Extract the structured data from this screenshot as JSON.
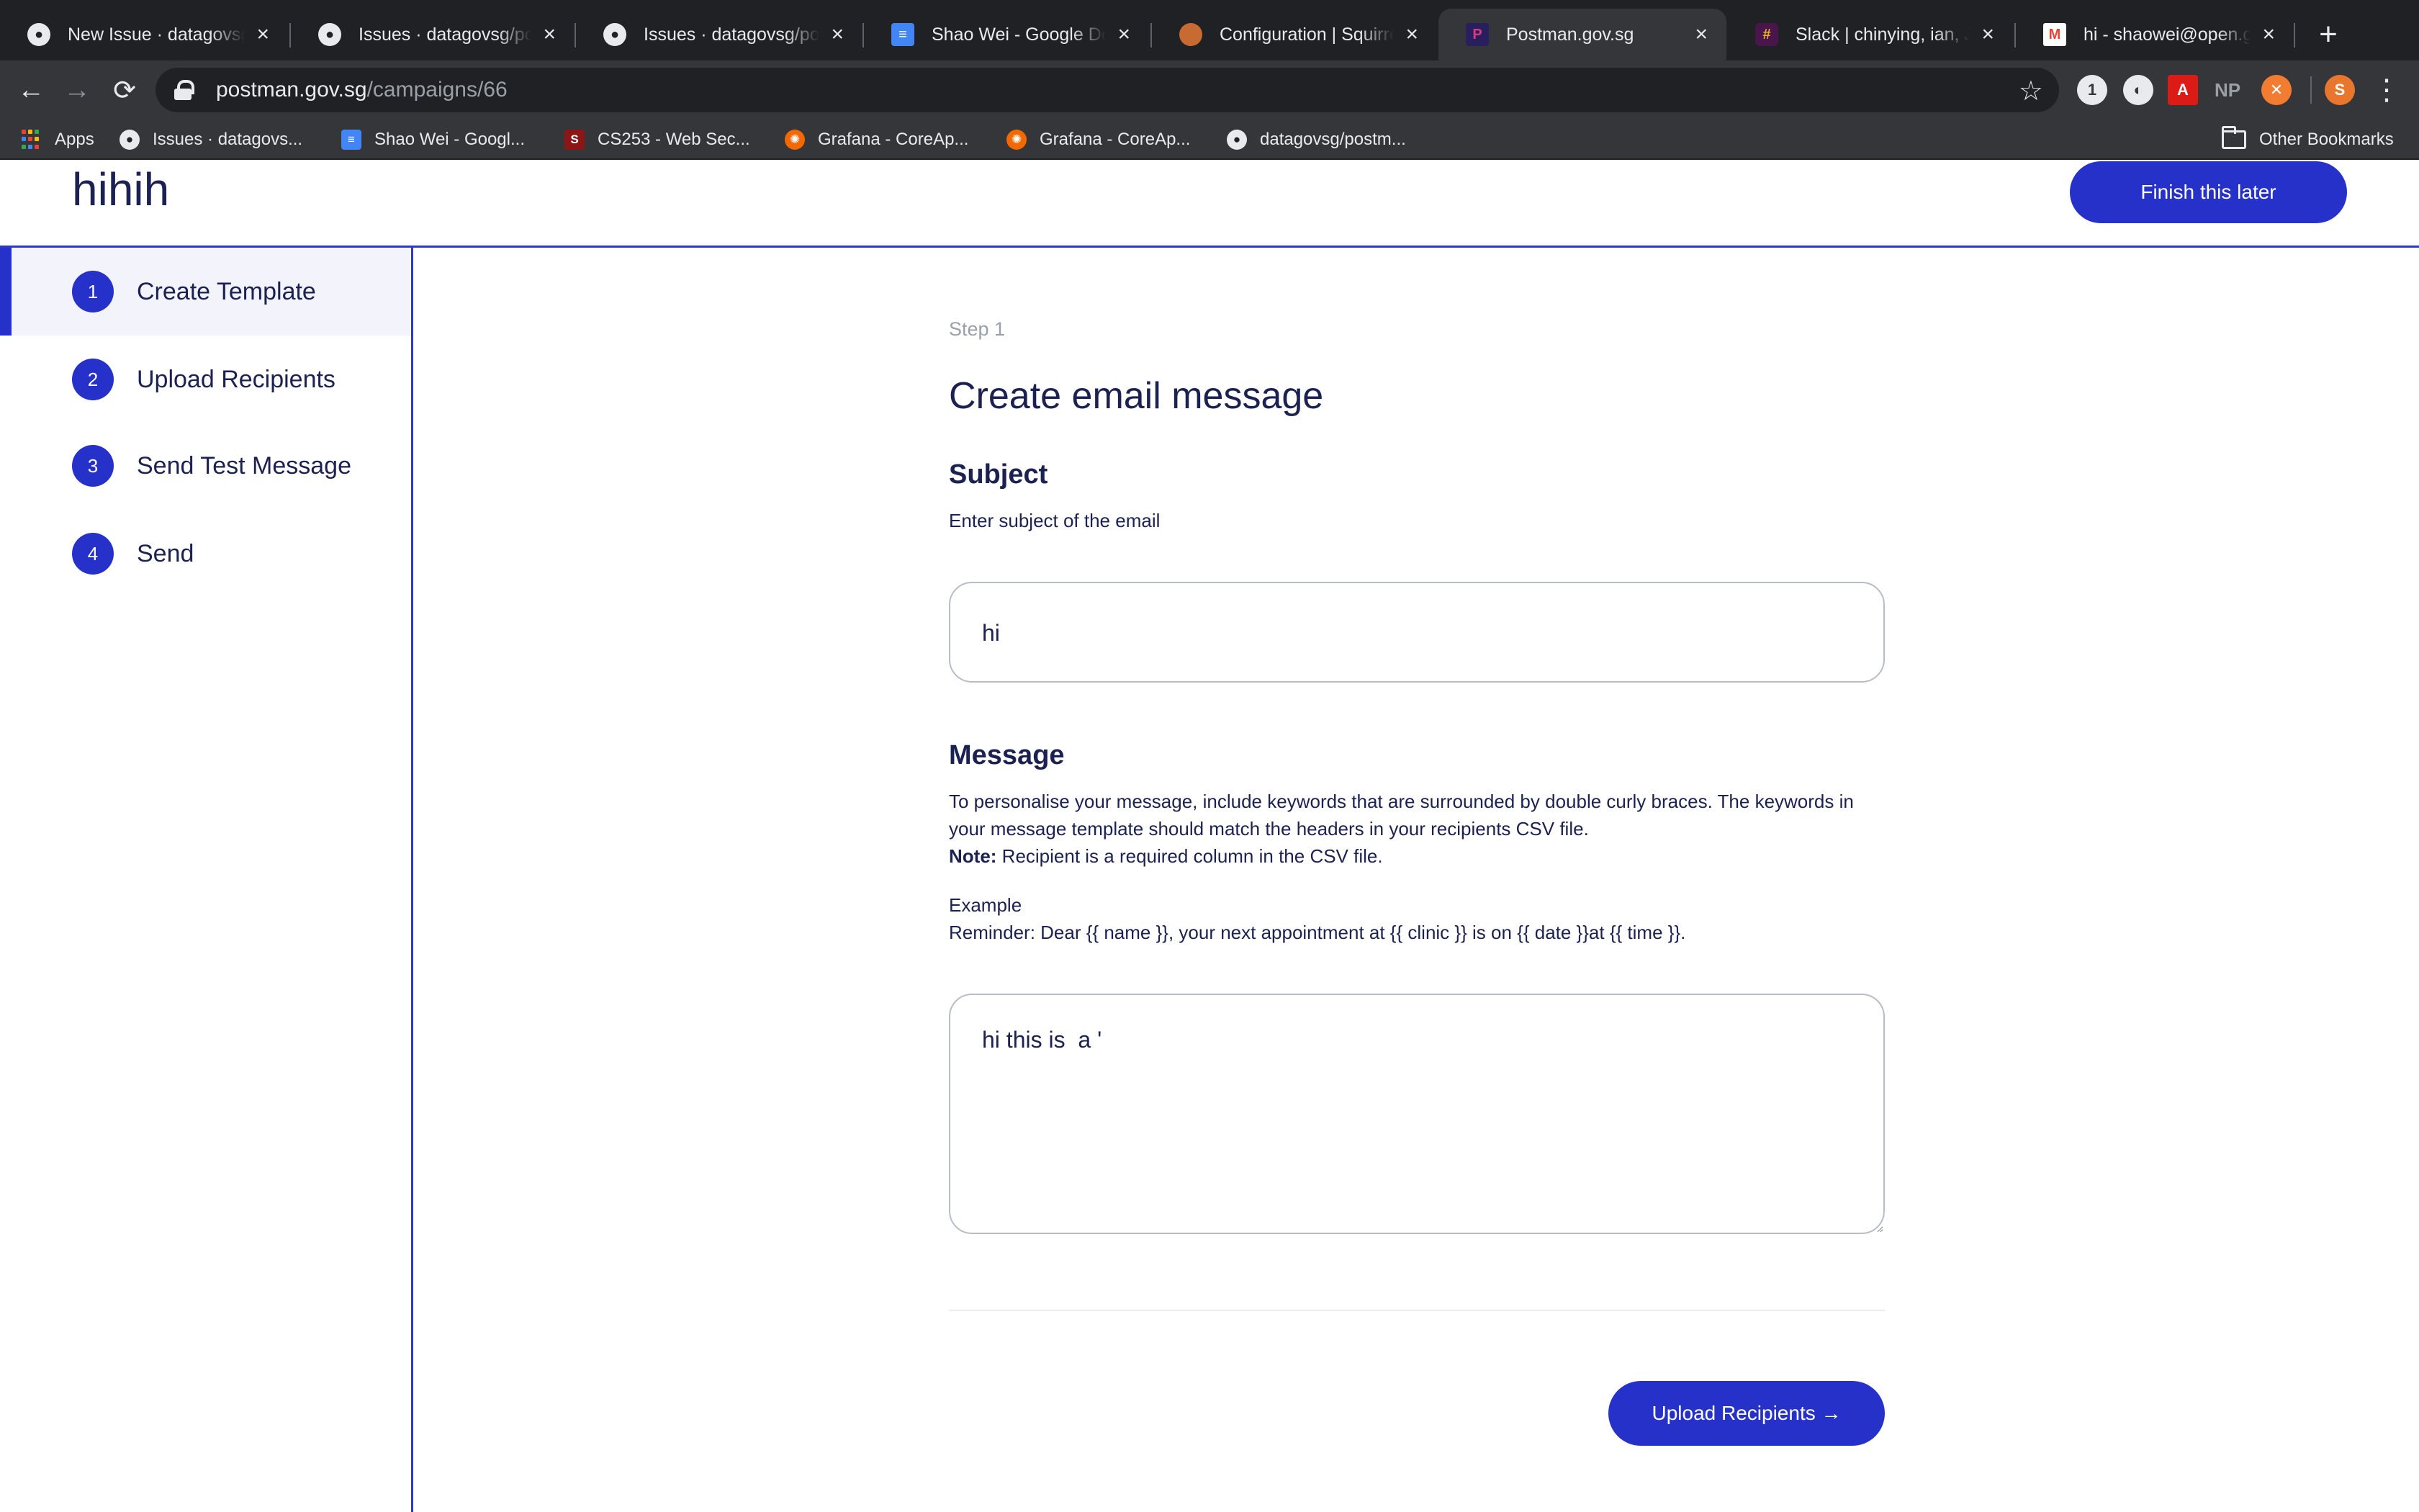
{
  "browser": {
    "tabs": [
      {
        "title": "New Issue · datagovsg/postman",
        "icon": "github-icon",
        "icon_color": "#e8eaed"
      },
      {
        "title": "Issues · datagovsg/postman",
        "icon": "github-icon",
        "icon_color": "#e8eaed"
      },
      {
        "title": "Issues · datagovsg/postman",
        "icon": "github-icon",
        "icon_color": "#e8eaed"
      },
      {
        "title": "Shao Wei - Google Docs",
        "icon": "google-docs-icon",
        "icon_color": "#4285f4"
      },
      {
        "title": "Configuration | SquirrelMail",
        "icon": "squirrel-icon",
        "icon_color": "#c86b32"
      },
      {
        "title": "Postman.gov.sg",
        "icon": "postman-icon",
        "icon_color": "#e0387a"
      },
      {
        "title": "Slack | chinying, ian, Jeff",
        "icon": "slack-icon",
        "icon_color": "#e01e5a"
      },
      {
        "title": "hi - shaowei@open.gov.sg",
        "icon": "gmail-icon",
        "icon_color": "#ea4335"
      }
    ],
    "new_tab_symbol": "+",
    "url": {
      "host": "postman.gov.sg",
      "path": "/campaigns/66"
    },
    "bookmarks": [
      {
        "label": "Apps",
        "icon": "apps-grid-icon"
      },
      {
        "label": "Issues · datagovs...",
        "icon": "github-icon"
      },
      {
        "label": "Shao Wei - Googl...",
        "icon": "google-docs-icon"
      },
      {
        "label": "CS253 - Web Sec...",
        "icon": "stanford-icon"
      },
      {
        "label": "Grafana - CoreAp...",
        "icon": "grafana-icon"
      },
      {
        "label": "Grafana - CoreAp...",
        "icon": "grafana-icon"
      },
      {
        "label": "datagovsg/postm...",
        "icon": "github-icon"
      }
    ],
    "other_bookmarks": "Other Bookmarks",
    "extensions": [
      "1password-icon",
      "extension-icon",
      "angular-icon",
      "np-extension-icon",
      "extension-orange-icon"
    ],
    "extension_np_label": "NP",
    "profile_initial": "S"
  },
  "app": {
    "campaign_name": "hihih",
    "finish_later_label": "Finish this later",
    "colors": {
      "primary": "#2631c9",
      "text": "#1b2151",
      "muted": "#9aa0aa"
    },
    "steps": [
      {
        "number": "1",
        "label": "Create Template",
        "active": true
      },
      {
        "number": "2",
        "label": "Upload Recipients",
        "active": false
      },
      {
        "number": "3",
        "label": "Send Test Message",
        "active": false
      },
      {
        "number": "4",
        "label": "Send",
        "active": false
      }
    ],
    "form": {
      "step_label": "Step 1",
      "heading": "Create email message",
      "subject_title": "Subject",
      "subject_help": "Enter subject of the email",
      "subject_value": "hi",
      "message_title": "Message",
      "message_help_1": "To personalise your message, include keywords that are surrounded by double curly braces. The keywords in your message template should match the headers in your recipients CSV file.",
      "note_label": "Note:",
      "note_text": " Recipient is a required column in the CSV file.",
      "example_label": "Example",
      "example_text": "Reminder: Dear {{ name }}, your next appointment at {{ clinic }} is on {{ date }}at {{ time }}.",
      "message_value": "hi this is  a '",
      "next_button_label": "Upload Recipients →"
    }
  }
}
